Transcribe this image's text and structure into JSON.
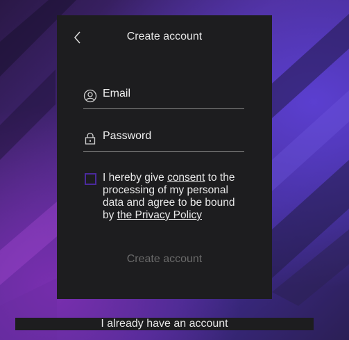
{
  "header": {
    "title": "Create account",
    "back_icon": "chevron-left-icon"
  },
  "form": {
    "email_label": "Email",
    "email_icon": "user-circle-icon",
    "password_label": "Password",
    "password_icon": "lock-icon",
    "consent": {
      "text_before": "I hereby give ",
      "consent_link": "consent",
      "text_middle": " to the processing of my personal data and agree to be bound by ",
      "policy_link": "the Privacy Policy",
      "checked": false
    },
    "submit_label": "Create account"
  },
  "footer": {
    "login_link": "I already have an account"
  },
  "colors": {
    "panel": "#1d1d1f",
    "checkbox_border": "#4a2a9c",
    "text": "#e8e8e8",
    "disabled_text": "#6a6a6a"
  }
}
